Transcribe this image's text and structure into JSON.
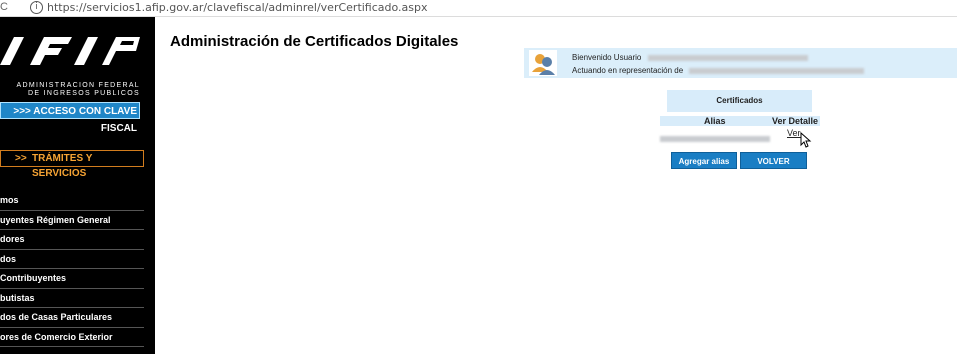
{
  "browser": {
    "url": "https://servicios1.afip.gov.ar/clavefiscal/adminrel/verCertificado.aspx",
    "info_icon": "info-icon"
  },
  "sidebar": {
    "logo_line1": "ADMINISTRACION FEDERAL",
    "logo_line2": "DE INGRESOS PUBLICOS",
    "clave_button": ">>> ACCESO CON CLAVE FISCAL",
    "tramites_arrow": ">>",
    "tramites_button": "TRÁMITES Y SERVICIOS",
    "menu": [
      "mos",
      "uyentes Régimen General",
      "dores",
      "dos",
      " Contribuyentes",
      "butistas",
      "dos de Casas Particulares",
      "ores de Comercio Exterior"
    ]
  },
  "main": {
    "title": "Administración de Certificados Digitales",
    "welcome_label": "Bienvenido Usuario",
    "representing_label": "Actuando en representación de",
    "table_title": "Certificados",
    "col_alias": "Alias",
    "col_detail": "Ver Detalle",
    "row_link": "Ver",
    "add_button": "Agregar alias",
    "back_button": "VOLVER"
  },
  "colors": {
    "sidebar_bg": "#000000",
    "accent_blue": "#1a7ec4",
    "panel_blue": "#dbeefa",
    "orange": "#f7a434"
  }
}
